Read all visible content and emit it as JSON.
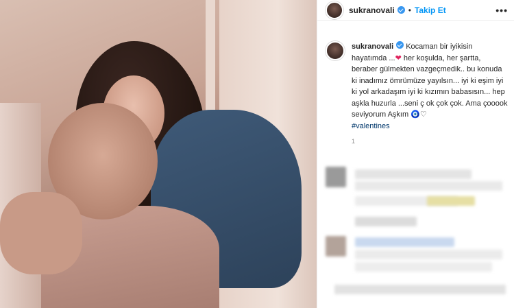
{
  "post": {
    "username": "sukranovali",
    "follow_label": "Takip Et",
    "separator": "•",
    "more_label": "•••"
  },
  "caption": {
    "username": "sukranovali",
    "text_part1": "Kocaman bir iyikisin hayatımda ...",
    "heart": "❤",
    "text_part2": "her koşulda, her şartta, beraber gülmekten vazgeçmedik.. bu konuda ki inadımız ömrümüze yayılsın... iyi ki eşim iyi ki yol arkadaşım iyi ki kızımın babasısın... hep aşkla huzurla ...seni ç ok çok çok. Ama çooook seviyorum Aşkım",
    "nazar": "🧿",
    "white_heart": "♡",
    "hashtag": "#valentines",
    "time": "1"
  },
  "colors": {
    "accent": "#0095f6",
    "verified": "#3897f0",
    "hashtag": "#00376b",
    "muted": "#8e8e8e"
  },
  "icons": {
    "verified": "verified-badge-icon",
    "more": "more-options-icon"
  }
}
